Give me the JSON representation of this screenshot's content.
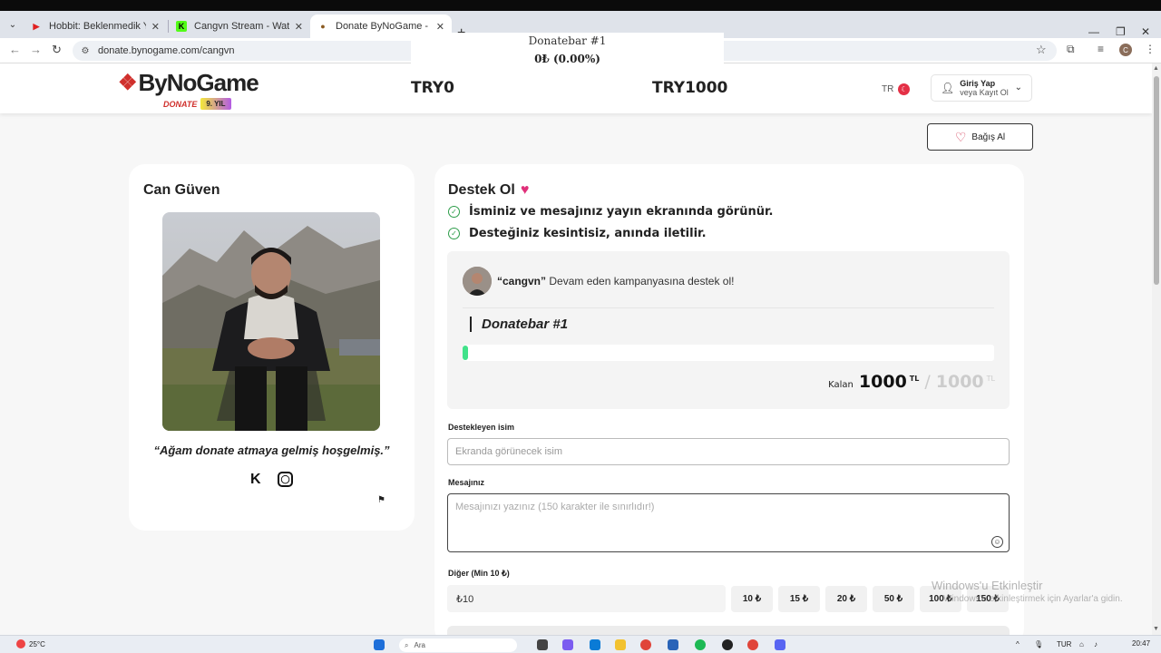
{
  "browser": {
    "tabs": [
      {
        "title": "Hobbit: Beklenmedik Yolculuk |",
        "favicon": "youtube-icon"
      },
      {
        "title": "Cangvn Stream - Watch Live on",
        "favicon": "kick-icon"
      },
      {
        "title": "Donate ByNoGame - Can Güven",
        "favicon": "bynogame-icon"
      }
    ],
    "url": "donate.bynogame.com/cangvn"
  },
  "overlay": {
    "title": "Donatebar #1",
    "amount": "0₺ (0.00%)"
  },
  "header": {
    "brand": "ByNoGame",
    "donate_word": "DONATE",
    "years_badge": "9. YIL",
    "try_left": "TRY0",
    "try_right": "TRY1000",
    "lang": "TR",
    "login_title": "Giriş Yap",
    "login_sub": "veya Kayıt Ol"
  },
  "bagis_button": "Bağış Al",
  "profile": {
    "name": "Can Güven",
    "quote": "“Ağam donate atmaya gelmiş hoşgelmiş.”"
  },
  "support": {
    "title": "Destek Ol",
    "bullets": [
      "İsminiz ve mesajınız yayın ekranında görünür.",
      "Desteğiniz kesintisiz, anında iletilir."
    ],
    "campaign_user": "“cangvn”",
    "campaign_text": " Devam eden kampanyasına destek ol!",
    "bar_title": "Donatebar #1",
    "progress_fraction": 0.01,
    "remaining_label": "Kalan",
    "remaining": "1000",
    "currency": "TL",
    "total": "1000"
  },
  "form": {
    "name_label": "Destekleyen isim",
    "name_placeholder": "Ekranda görünecek isim",
    "message_label": "Mesajınız",
    "message_placeholder": "Mesajınızı yazınız (150 karakter ile sınırlıdır!)",
    "other_label": "Diğer (Min 10 ₺)",
    "amount_value": "₺10",
    "amounts": [
      "10 ₺",
      "15 ₺",
      "20 ₺",
      "50 ₺",
      "100 ₺",
      "150 ₺"
    ]
  },
  "watermark": {
    "line1": "Windows'u Etkinleştir",
    "line2": "Windows'u etkinleştirmek için Ayarlar'a gidin."
  },
  "taskbar": {
    "temp": "25°C",
    "search": "Ara",
    "lang": "TUR",
    "time": "20:47"
  }
}
